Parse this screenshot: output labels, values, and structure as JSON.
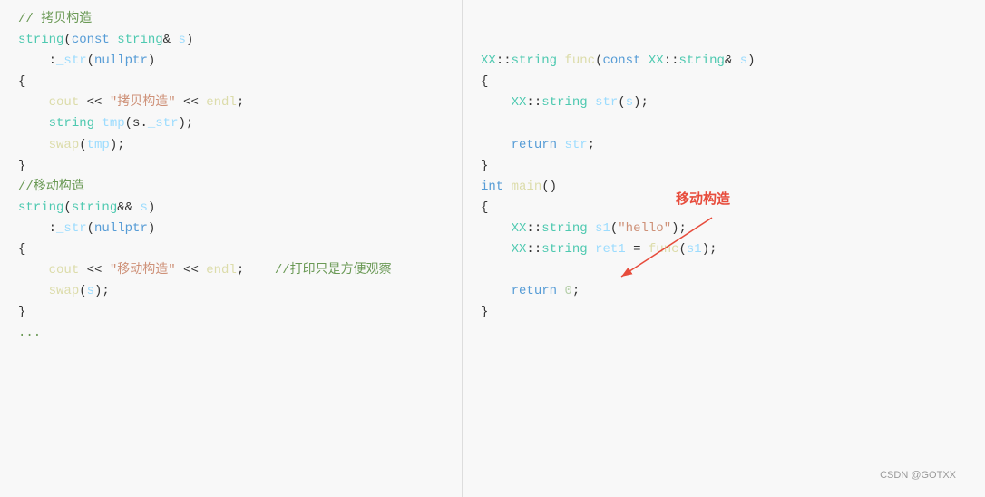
{
  "left": {
    "lines": [
      {
        "type": "comment",
        "text": "// 拷贝构造"
      },
      {
        "type": "code",
        "parts": [
          {
            "cls": "c-type",
            "text": "string"
          },
          {
            "cls": "c-plain",
            "text": "("
          },
          {
            "cls": "c-keyword",
            "text": "const"
          },
          {
            "cls": "c-plain",
            "text": " "
          },
          {
            "cls": "c-type",
            "text": "string"
          },
          {
            "cls": "c-plain",
            "text": "& "
          },
          {
            "cls": "c-param",
            "text": "s"
          },
          {
            "cls": "c-plain",
            "text": ")"
          }
        ]
      },
      {
        "type": "code",
        "parts": [
          {
            "cls": "c-plain",
            "text": "    :"
          },
          {
            "cls": "c-init",
            "text": "_str"
          },
          {
            "cls": "c-plain",
            "text": "("
          },
          {
            "cls": "c-keyword",
            "text": "nullptr"
          },
          {
            "cls": "c-plain",
            "text": ")"
          }
        ]
      },
      {
        "type": "brace",
        "text": "{"
      },
      {
        "type": "code",
        "parts": [
          {
            "cls": "c-plain",
            "text": "    "
          },
          {
            "cls": "c-func",
            "text": "cout"
          },
          {
            "cls": "c-plain",
            "text": " << "
          },
          {
            "cls": "c-string",
            "text": "\"拷贝构造\""
          },
          {
            "cls": "c-plain",
            "text": " << "
          },
          {
            "cls": "c-func",
            "text": "endl"
          },
          {
            "cls": "c-plain",
            "text": ";"
          }
        ]
      },
      {
        "type": "code",
        "parts": [
          {
            "cls": "c-plain",
            "text": "    "
          },
          {
            "cls": "c-type",
            "text": "string"
          },
          {
            "cls": "c-plain",
            "text": " "
          },
          {
            "cls": "c-param",
            "text": "tmp"
          },
          {
            "cls": "c-plain",
            "text": "(s."
          },
          {
            "cls": "c-init",
            "text": "_str"
          },
          {
            "cls": "c-plain",
            "text": ");"
          }
        ]
      },
      {
        "type": "code",
        "parts": [
          {
            "cls": "c-plain",
            "text": "    "
          },
          {
            "cls": "c-func",
            "text": "swap"
          },
          {
            "cls": "c-plain",
            "text": "("
          },
          {
            "cls": "c-param",
            "text": "tmp"
          },
          {
            "cls": "c-plain",
            "text": ");"
          }
        ]
      },
      {
        "type": "brace",
        "text": "}"
      },
      {
        "type": "comment",
        "text": "//移动构造"
      },
      {
        "type": "code",
        "parts": [
          {
            "cls": "c-type",
            "text": "string"
          },
          {
            "cls": "c-plain",
            "text": "("
          },
          {
            "cls": "c-type",
            "text": "string"
          },
          {
            "cls": "c-plain",
            "text": "&& "
          },
          {
            "cls": "c-param",
            "text": "s"
          },
          {
            "cls": "c-plain",
            "text": ")"
          }
        ]
      },
      {
        "type": "code",
        "parts": [
          {
            "cls": "c-plain",
            "text": "    :"
          },
          {
            "cls": "c-init",
            "text": "_str"
          },
          {
            "cls": "c-plain",
            "text": "("
          },
          {
            "cls": "c-keyword",
            "text": "nullptr"
          },
          {
            "cls": "c-plain",
            "text": ")"
          }
        ]
      },
      {
        "type": "brace",
        "text": "{"
      },
      {
        "type": "code",
        "parts": [
          {
            "cls": "c-plain",
            "text": "    "
          },
          {
            "cls": "c-func",
            "text": "cout"
          },
          {
            "cls": "c-plain",
            "text": " << "
          },
          {
            "cls": "c-string",
            "text": "\"移动构造\""
          },
          {
            "cls": "c-plain",
            "text": " << "
          },
          {
            "cls": "c-func",
            "text": "endl"
          },
          {
            "cls": "c-plain",
            "text": ";    "
          },
          {
            "cls": "c-comment",
            "text": "//打印只是方便观察"
          }
        ]
      },
      {
        "type": "code",
        "parts": [
          {
            "cls": "c-plain",
            "text": "    "
          },
          {
            "cls": "c-func",
            "text": "swap"
          },
          {
            "cls": "c-plain",
            "text": "("
          },
          {
            "cls": "c-param",
            "text": "s"
          },
          {
            "cls": "c-plain",
            "text": ");"
          }
        ]
      },
      {
        "type": "brace",
        "text": "}"
      },
      {
        "type": "comment",
        "text": "..."
      }
    ]
  },
  "right": {
    "lines": [
      {
        "type": "blank"
      },
      {
        "type": "blank"
      },
      {
        "type": "code",
        "parts": [
          {
            "cls": "c-ns",
            "text": "XX"
          },
          {
            "cls": "c-plain",
            "text": "::"
          },
          {
            "cls": "c-type",
            "text": "string"
          },
          {
            "cls": "c-plain",
            "text": " "
          },
          {
            "cls": "c-func",
            "text": "func"
          },
          {
            "cls": "c-plain",
            "text": "("
          },
          {
            "cls": "c-keyword",
            "text": "const"
          },
          {
            "cls": "c-plain",
            "text": " "
          },
          {
            "cls": "c-ns",
            "text": "XX"
          },
          {
            "cls": "c-plain",
            "text": "::"
          },
          {
            "cls": "c-type",
            "text": "string"
          },
          {
            "cls": "c-plain",
            "text": "& "
          },
          {
            "cls": "c-param",
            "text": "s"
          },
          {
            "cls": "c-plain",
            "text": ")"
          }
        ]
      },
      {
        "type": "brace",
        "text": "{"
      },
      {
        "type": "code",
        "parts": [
          {
            "cls": "c-plain",
            "text": "    "
          },
          {
            "cls": "c-ns",
            "text": "XX"
          },
          {
            "cls": "c-plain",
            "text": "::"
          },
          {
            "cls": "c-type",
            "text": "string"
          },
          {
            "cls": "c-plain",
            "text": " "
          },
          {
            "cls": "c-param",
            "text": "str"
          },
          {
            "cls": "c-plain",
            "text": "("
          },
          {
            "cls": "c-param",
            "text": "s"
          },
          {
            "cls": "c-plain",
            "text": ");"
          }
        ]
      },
      {
        "type": "blank"
      },
      {
        "type": "code",
        "parts": [
          {
            "cls": "c-plain",
            "text": "    "
          },
          {
            "cls": "c-keyword",
            "text": "return"
          },
          {
            "cls": "c-plain",
            "text": " "
          },
          {
            "cls": "c-param",
            "text": "str"
          },
          {
            "cls": "c-plain",
            "text": ";"
          }
        ]
      },
      {
        "type": "brace",
        "text": "}"
      },
      {
        "type": "code",
        "parts": [
          {
            "cls": "c-keyword",
            "text": "int"
          },
          {
            "cls": "c-plain",
            "text": " "
          },
          {
            "cls": "c-func",
            "text": "main"
          },
          {
            "cls": "c-plain",
            "text": "()"
          }
        ]
      },
      {
        "type": "brace",
        "text": "{"
      },
      {
        "type": "code",
        "parts": [
          {
            "cls": "c-plain",
            "text": "    "
          },
          {
            "cls": "c-ns",
            "text": "XX"
          },
          {
            "cls": "c-plain",
            "text": "::"
          },
          {
            "cls": "c-type",
            "text": "string"
          },
          {
            "cls": "c-plain",
            "text": " "
          },
          {
            "cls": "c-param",
            "text": "s1"
          },
          {
            "cls": "c-plain",
            "text": "("
          },
          {
            "cls": "c-string",
            "text": "\"hello\""
          },
          {
            "cls": "c-plain",
            "text": ");"
          }
        ]
      },
      {
        "type": "code",
        "parts": [
          {
            "cls": "c-plain",
            "text": "    "
          },
          {
            "cls": "c-ns",
            "text": "XX"
          },
          {
            "cls": "c-plain",
            "text": "::"
          },
          {
            "cls": "c-type",
            "text": "string"
          },
          {
            "cls": "c-plain",
            "text": " "
          },
          {
            "cls": "c-param",
            "text": "ret1"
          },
          {
            "cls": "c-plain",
            "text": " = "
          },
          {
            "cls": "c-func",
            "text": "func"
          },
          {
            "cls": "c-plain",
            "text": "("
          },
          {
            "cls": "c-param",
            "text": "s1"
          },
          {
            "cls": "c-plain",
            "text": ");"
          }
        ]
      },
      {
        "type": "blank"
      },
      {
        "type": "code",
        "parts": [
          {
            "cls": "c-plain",
            "text": "    "
          },
          {
            "cls": "c-keyword",
            "text": "return"
          },
          {
            "cls": "c-plain",
            "text": " "
          },
          {
            "cls": "c-number",
            "text": "0"
          },
          {
            "cls": "c-plain",
            "text": ";"
          }
        ]
      },
      {
        "type": "brace",
        "text": "}"
      }
    ],
    "annotation": {
      "label": "移动构造",
      "color": "#e74c3c"
    }
  },
  "watermark": "CSDN @GOTXX"
}
